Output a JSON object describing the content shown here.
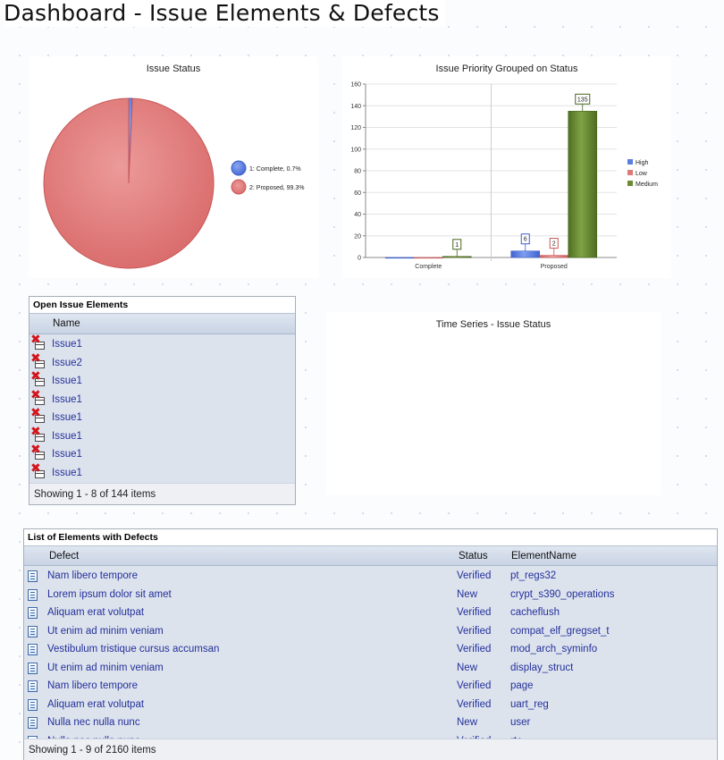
{
  "page": {
    "title": "Dashboard - Issue Elements & Defects"
  },
  "issue_status": {
    "title": "Issue Status",
    "legend": [
      {
        "label": "1: Complete, 0.7%",
        "color": "#5b7fe0"
      },
      {
        "label": "2: Proposed, 99.3%",
        "color": "#e07878"
      }
    ]
  },
  "priority_chart": {
    "title": "Issue Priority Grouped on Status",
    "legend": [
      {
        "label": "High",
        "color": "#5b7fe0"
      },
      {
        "label": "Low",
        "color": "#e07878"
      },
      {
        "label": "Medium",
        "color": "#6a8a34"
      }
    ]
  },
  "time_series": {
    "title": "Time Series - Issue Status"
  },
  "chart_data": [
    {
      "type": "pie",
      "title": "Issue Status",
      "categories": [
        "1: Complete, 0.7%",
        "2: Proposed, 99.3%"
      ],
      "values": [
        0.7,
        99.3
      ],
      "colors": [
        "#5b7fe0",
        "#e07878"
      ],
      "legend_position": "right"
    },
    {
      "type": "bar",
      "title": "Issue Priority Grouped on Status",
      "categories": [
        "Complete",
        "Proposed"
      ],
      "series": [
        {
          "name": "High",
          "values": [
            0,
            6
          ],
          "labels": [
            null,
            "6"
          ],
          "color": "#5b7fe0"
        },
        {
          "name": "Low",
          "values": [
            0,
            2
          ],
          "labels": [
            null,
            "2"
          ],
          "color": "#e07878"
        },
        {
          "name": "Medium",
          "values": [
            1,
            135
          ],
          "labels": [
            "1",
            "135"
          ],
          "color": "#6a8a34"
        }
      ],
      "ylim": [
        0,
        160
      ],
      "yticks": [
        0,
        20,
        40,
        60,
        80,
        100,
        120,
        140,
        160
      ],
      "grid": true,
      "legend_position": "right"
    }
  ],
  "open_issues": {
    "header": "Open Issue Elements",
    "column": "Name",
    "rows": [
      "Issue1",
      "Issue2",
      "Issue1",
      "Issue1",
      "Issue1",
      "Issue1",
      "Issue1",
      "Issue1"
    ],
    "footer": "Showing 1 - 8 of 144 items"
  },
  "defects": {
    "header": "List of Elements with Defects",
    "columns": {
      "defect": "Defect",
      "status": "Status",
      "element": "ElementName"
    },
    "rows": [
      {
        "defect": "Nam libero tempore",
        "status": "Verified",
        "element": "pt_regs32"
      },
      {
        "defect": "Lorem ipsum dolor sit amet",
        "status": "New",
        "element": "crypt_s390_operations"
      },
      {
        "defect": "Aliquam erat volutpat",
        "status": "Verified",
        "element": "cacheflush"
      },
      {
        "defect": "Ut enim ad minim veniam",
        "status": "Verified",
        "element": "compat_elf_gregset_t"
      },
      {
        "defect": "Vestibulum tristique cursus accumsan",
        "status": "Verified",
        "element": "mod_arch_syminfo"
      },
      {
        "defect": "Ut enim ad minim veniam",
        "status": "New",
        "element": "display_struct"
      },
      {
        "defect": "Nam libero tempore",
        "status": "Verified",
        "element": "page"
      },
      {
        "defect": "Aliquam erat volutpat",
        "status": "Verified",
        "element": "uart_reg"
      },
      {
        "defect": "Nulla nec nulla nunc",
        "status": "New",
        "element": "user"
      },
      {
        "defect": "Nulla nec nulla nunc",
        "status": "Verified",
        "element": "rtc"
      }
    ],
    "footer": "Showing 1 - 9 of 2160 items"
  }
}
